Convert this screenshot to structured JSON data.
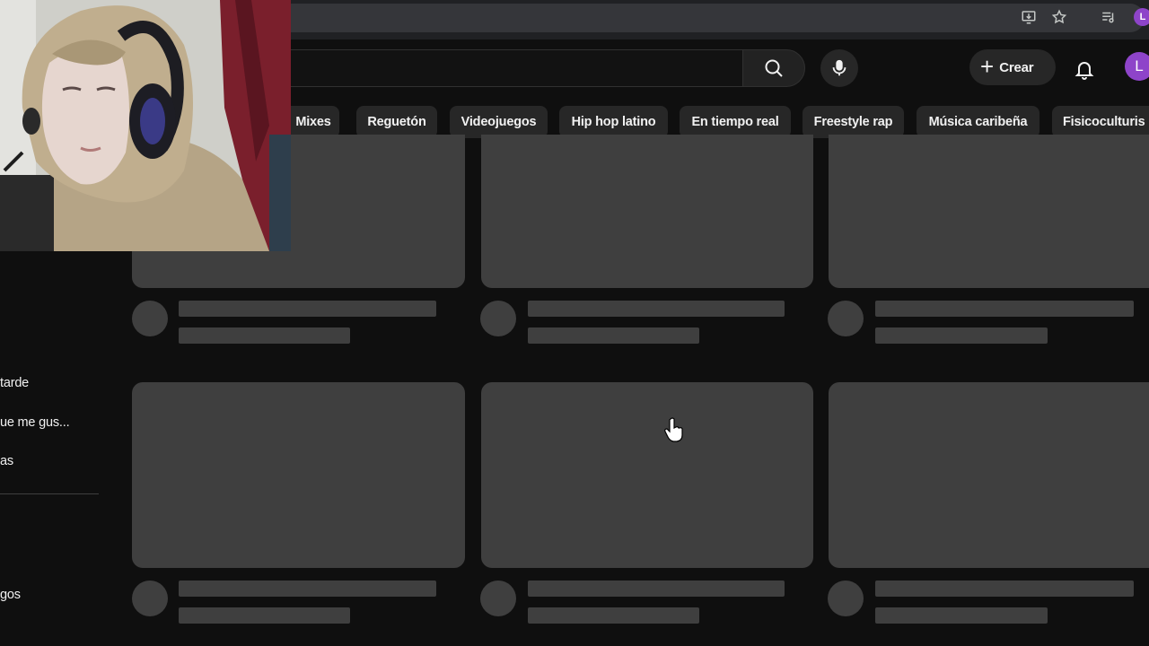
{
  "browser": {
    "icons": [
      "install-app-icon",
      "star-icon",
      "media-queue-icon"
    ],
    "profile_initial": "L"
  },
  "header": {
    "search": {
      "placeholder": "",
      "value": ""
    },
    "create_label": "Crear",
    "avatar_initial": "L",
    "icons": [
      "search-icon",
      "mic-icon",
      "plus-icon",
      "bell-icon"
    ]
  },
  "chips": [
    {
      "label": "Mixes"
    },
    {
      "label": "Reguetón"
    },
    {
      "label": "Videojuegos"
    },
    {
      "label": "Hip hop latino"
    },
    {
      "label": "En tiempo real"
    },
    {
      "label": "Freestyle rap"
    },
    {
      "label": "Música caribeña"
    },
    {
      "label": "Fisicoculturis"
    }
  ],
  "sidebar": {
    "items": [
      {
        "label": "tarde"
      },
      {
        "label": "ue me gus..."
      },
      {
        "label": "as"
      },
      {
        "label": "gos"
      }
    ]
  },
  "colors": {
    "background": "#0f0f0f",
    "skeleton": "#3f3f3f",
    "chip": "#272727",
    "avatar": "#8e44c9"
  }
}
